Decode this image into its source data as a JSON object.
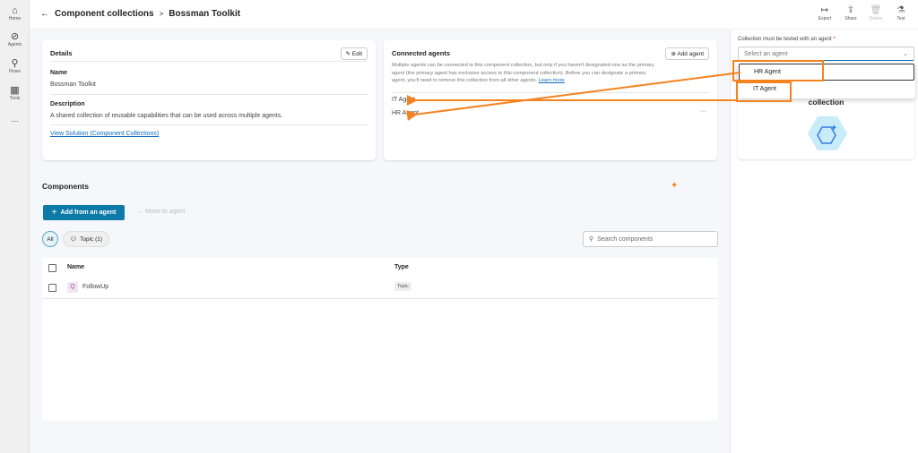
{
  "sidebar": {
    "items": [
      {
        "label": "Home",
        "icon": "home-icon"
      },
      {
        "label": "Agents",
        "icon": "agents-icon"
      },
      {
        "label": "Flows",
        "icon": "flows-icon"
      },
      {
        "label": "Tools",
        "icon": "tools-icon"
      }
    ],
    "more": "..."
  },
  "header": {
    "back": "←",
    "breadcrumb": [
      "Component collections",
      "Bossman Toolkit"
    ],
    "separator": ">",
    "toolbar": [
      {
        "label": "Export",
        "icon": "export-icon"
      },
      {
        "label": "Share",
        "icon": "share-icon"
      },
      {
        "label": "Delete",
        "icon": "delete-icon"
      },
      {
        "label": "Test",
        "icon": "test-icon"
      }
    ]
  },
  "details": {
    "title": "Details",
    "edit": "Edit",
    "name_label": "Name",
    "name": "Bossman Toolkit",
    "desc_label": "Description",
    "desc": "A shared collection of reusable capabilities that can be used across multiple agents.",
    "link": "View Solution (Component Collections)"
  },
  "connected": {
    "title": "Connected agents",
    "add": "Add agent",
    "info": "Multiple agents can be connected to this component collection, but only if you haven't designated one as the primary agent (the primary agent has exclusive access to this component collection). Before you can designate a primary agent, you'll need to remove this collection from all other agents.",
    "learn": "Learn more",
    "agents": [
      "IT Agent",
      "HR Agent"
    ],
    "more": "···"
  },
  "components": {
    "title": "Components",
    "add": "Add from an agent",
    "move": "Move to agent",
    "filters": [
      "All",
      "Topic (1)"
    ],
    "search_placeholder": "Search components",
    "columns": [
      "Name",
      "Type"
    ],
    "rows": [
      {
        "name": "FollowUp",
        "type": "Topic"
      }
    ]
  },
  "test_panel": {
    "label": "Collection must be tested with an agent",
    "required": "*",
    "placeholder": "Select an agent",
    "options": [
      "HR Agent",
      "IT Agent"
    ],
    "card_title": "collection"
  },
  "colors": {
    "accent": "#0f6cbd",
    "annotation": "#f5821f",
    "button": "#0e7aa8"
  }
}
